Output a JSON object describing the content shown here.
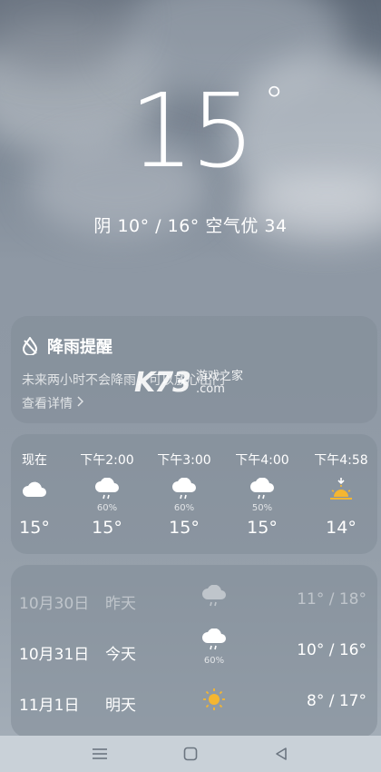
{
  "current": {
    "temperature": "15",
    "degree_symbol": "°",
    "summary": "阴 10° / 16° 空气优 34"
  },
  "rain_alert": {
    "icon": "rain-off-icon",
    "title": "降雨提醒",
    "description": "未来两小时不会降雨，可以放心出门",
    "link_label": "查看详情"
  },
  "watermark": {
    "logo": "K73",
    "line1": "游戏之家",
    "line2": ".com"
  },
  "hourly": [
    {
      "label": "现在",
      "icon": "cloud-icon",
      "pop": "",
      "temp": "15°"
    },
    {
      "label": "下午2:00",
      "icon": "rain-cloud-icon",
      "pop": "60%",
      "temp": "15°"
    },
    {
      "label": "下午3:00",
      "icon": "rain-cloud-icon",
      "pop": "60%",
      "temp": "15°"
    },
    {
      "label": "下午4:00",
      "icon": "rain-cloud-icon",
      "pop": "50%",
      "temp": "15°"
    },
    {
      "label": "下午4:58",
      "icon": "sunset-icon",
      "pop": "",
      "temp": "14°"
    }
  ],
  "daily": [
    {
      "date": "10月30日",
      "relative": "昨天",
      "icon": "cloud-icon",
      "pop": "",
      "range": "11° / 18°"
    },
    {
      "date": "10月31日",
      "relative": "今天",
      "icon": "rain-cloud-icon",
      "pop": "60%",
      "range": "10° / 16°"
    },
    {
      "date": "11月1日",
      "relative": "明天",
      "icon": "sun-icon",
      "pop": "",
      "range": "8° / 17°"
    }
  ],
  "navbar": {
    "items": [
      "menu-icon",
      "home-icon",
      "back-icon"
    ]
  },
  "colors": {
    "sun": "#f5b630",
    "card": "#828c98",
    "navbar": "#c9d1d8"
  }
}
